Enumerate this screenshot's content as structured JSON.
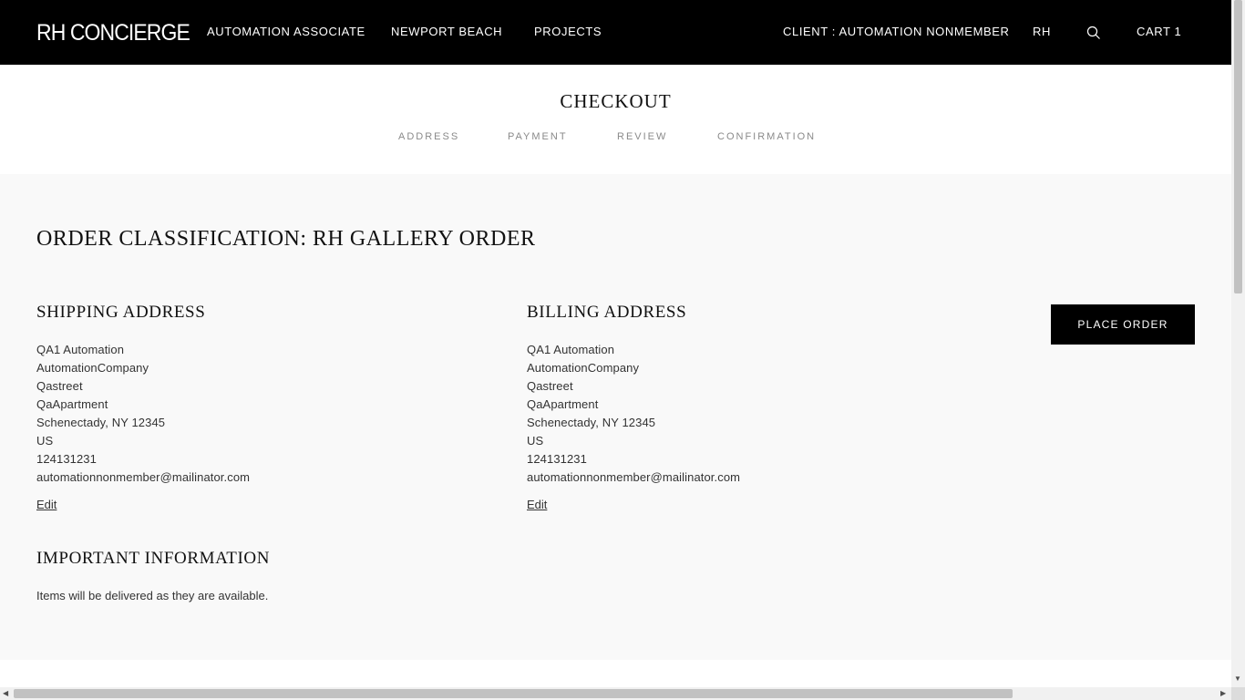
{
  "header": {
    "logo": "RH CONCIERGE",
    "nav": [
      "AUTOMATION ASSOCIATE",
      "NEWPORT BEACH",
      "PROJECTS"
    ],
    "client": "CLIENT : AUTOMATION NONMEMBER",
    "rh": "RH",
    "cart": "CART 1"
  },
  "checkout": {
    "title": "CHECKOUT",
    "steps": [
      "ADDRESS",
      "PAYMENT",
      "REVIEW",
      "CONFIRMATION"
    ]
  },
  "order": {
    "classification": "ORDER CLASSIFICATION: RH GALLERY ORDER",
    "place_order_label": "PLACE ORDER"
  },
  "shipping": {
    "title": "SHIPPING ADDRESS",
    "lines": [
      "QA1 Automation",
      "AutomationCompany",
      "Qastreet",
      "QaApartment",
      "Schenectady, NY 12345",
      "US",
      "124131231",
      "automationnonmember@mailinator.com"
    ],
    "edit": "Edit"
  },
  "billing": {
    "title": "BILLING ADDRESS",
    "lines": [
      "QA1 Automation",
      "AutomationCompany",
      "Qastreet",
      "QaApartment",
      "Schenectady, NY 12345",
      "US",
      "124131231",
      "automationnonmember@mailinator.com"
    ],
    "edit": "Edit"
  },
  "important": {
    "title": "IMPORTANT INFORMATION",
    "text": "Items will be delivered as they are available."
  },
  "icons": {
    "search": "search-icon"
  },
  "colors": {
    "header_bg": "#000000",
    "page_bg": "#f9f9f9",
    "step_text": "#8a8a8a"
  }
}
